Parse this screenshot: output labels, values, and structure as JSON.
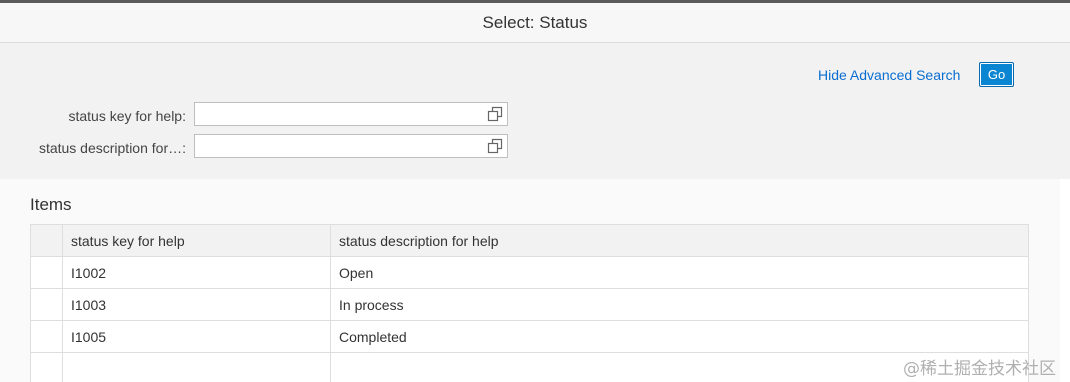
{
  "dialog": {
    "title": "Select: Status"
  },
  "filter": {
    "advanced_search_link": "Hide Advanced Search",
    "go_button": "Go",
    "fields": [
      {
        "label": "status key for help:",
        "value": ""
      },
      {
        "label": "status description for…:",
        "value": ""
      }
    ],
    "value_help_icon": "value-help-icon"
  },
  "items": {
    "title": "Items",
    "columns": [
      "status key for help",
      "status description for help"
    ],
    "rows": [
      {
        "key": "I1002",
        "description": "Open"
      },
      {
        "key": "I1003",
        "description": "In process"
      },
      {
        "key": "I1005",
        "description": "Completed"
      },
      {
        "key": "",
        "description": ""
      }
    ]
  },
  "watermark": "@稀土掘金技术社区",
  "colors": {
    "accent": "#0a6ed1",
    "go_button": "#0a85d1",
    "header_bg": "#f7f7f7",
    "filter_bg": "#f2f2f2"
  }
}
